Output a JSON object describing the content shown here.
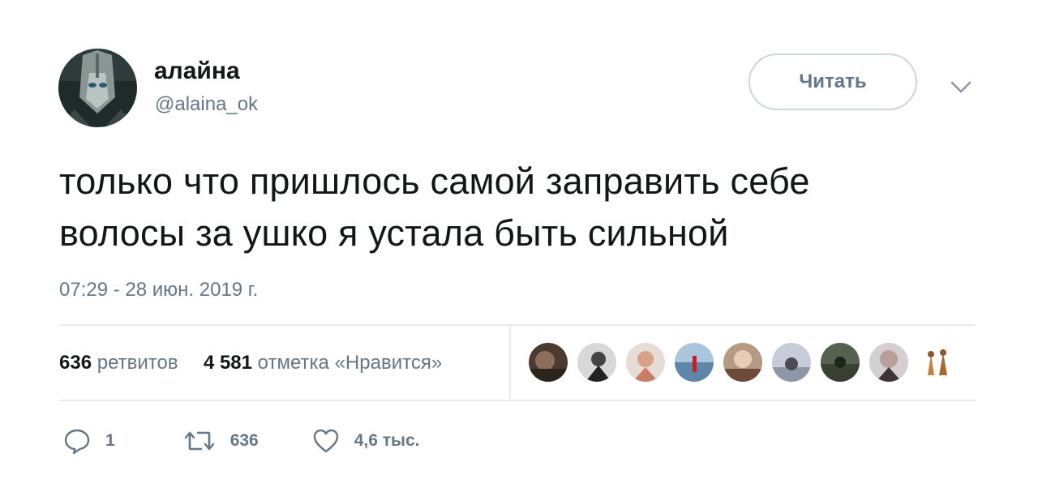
{
  "author": {
    "display_name": "алайна",
    "handle": "@alaina_ok"
  },
  "follow_button": {
    "label": "Читать"
  },
  "tweet": {
    "text_line1": "только что пришлось самой заправить себе",
    "text_line2": "волосы за ушко я устала быть сильной",
    "timestamp": "07:29 - 28 июн. 2019 г."
  },
  "stats": {
    "retweets_count": "636",
    "retweets_label": "ретвитов",
    "likes_count": "4 581",
    "likes_label": "отметка «Нравится»"
  },
  "likers_count_shown": 9,
  "actions": {
    "reply_count": "1",
    "retweet_count": "636",
    "like_count": "4,6 тыс."
  },
  "colors": {
    "text": "#14171a",
    "secondary": "#657786",
    "border": "#e6ecf0",
    "button_border": "#ccd6dd"
  },
  "icons": [
    "reply-icon",
    "retweet-icon",
    "like-icon",
    "caret-down-icon"
  ]
}
